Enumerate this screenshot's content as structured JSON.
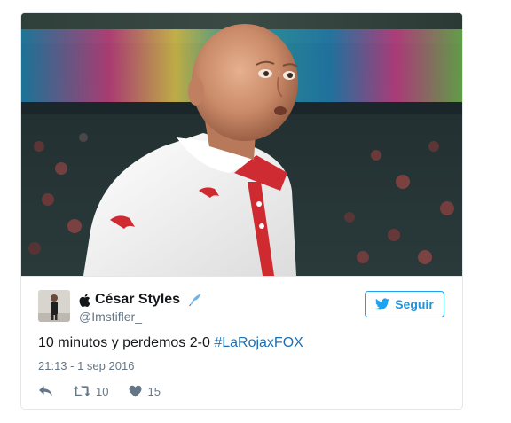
{
  "tweet": {
    "display_name": "César Styles",
    "handle": "@Imstifler_",
    "follow_label": "Seguir",
    "text_prefix": "10 minutos y perdemos 2-0 ",
    "hashtag": "#LaRojaxFOX",
    "timestamp": "21:13 - 1 sep 2016",
    "retweet_count": "10",
    "like_count": "15"
  },
  "icons": {
    "name_prefix": "apple-icon",
    "verified": "feather-quill-icon",
    "follow": "bird-icon",
    "reply": "reply-icon",
    "retweet": "retweet-icon",
    "like": "heart-icon"
  },
  "colors": {
    "link": "#1b6fb5",
    "follow_accent": "#1da1f2",
    "muted": "#657786",
    "text": "#14171a",
    "border": "#e1e8ed"
  }
}
